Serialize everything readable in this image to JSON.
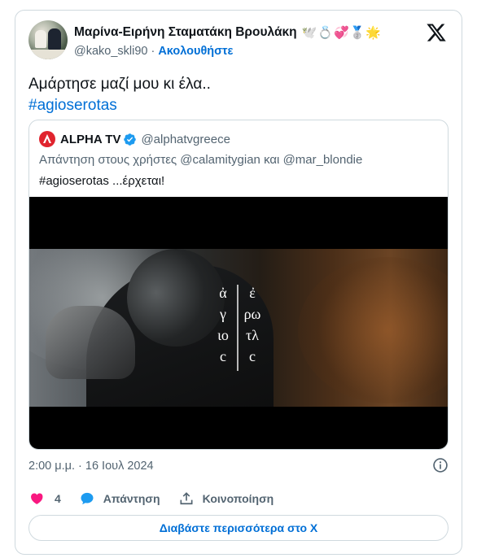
{
  "author": {
    "display_name": "Μαρίνα-Ειρήνη Σταματάκη Βρουλάκη",
    "emoji_badges": "🕊️💍💞🥈🌟",
    "handle": "@kako_skli90",
    "separator": "·",
    "follow_label": "Ακολουθήστε"
  },
  "tweet": {
    "text": "Αμάρτησε μαζί μου κι έλα..",
    "hashtag": "#agioserotas"
  },
  "quoted": {
    "name": "ALPHA TV",
    "handle": "@alphatvgreece",
    "reply_prefix": "Απάντηση στους χρήστες",
    "mention_1": "@calamitygian",
    "reply_joiner": "και",
    "mention_2": "@mar_blondie",
    "text": "#agioserotas ...έρχεται!",
    "video_title_lines": {
      "left": [
        "ἀ",
        "γ",
        "ιο",
        "c"
      ],
      "right": [
        "ἐ",
        "ρω",
        "τλ",
        "c"
      ]
    }
  },
  "meta": {
    "timestamp": "2:00 μ.μ. · 16 Ιουλ 2024"
  },
  "actions": {
    "like_count": "4",
    "reply_label": "Απάντηση",
    "share_label": "Κοινοποίηση"
  },
  "read_more_label": "Διαβάστε περισσότερα στο X",
  "colors": {
    "accent": "#006fd6",
    "like": "#f91880",
    "reply": "#1d9bf0",
    "muted": "#536471",
    "border": "#cfd9de",
    "alpha_red": "#e0242e"
  }
}
